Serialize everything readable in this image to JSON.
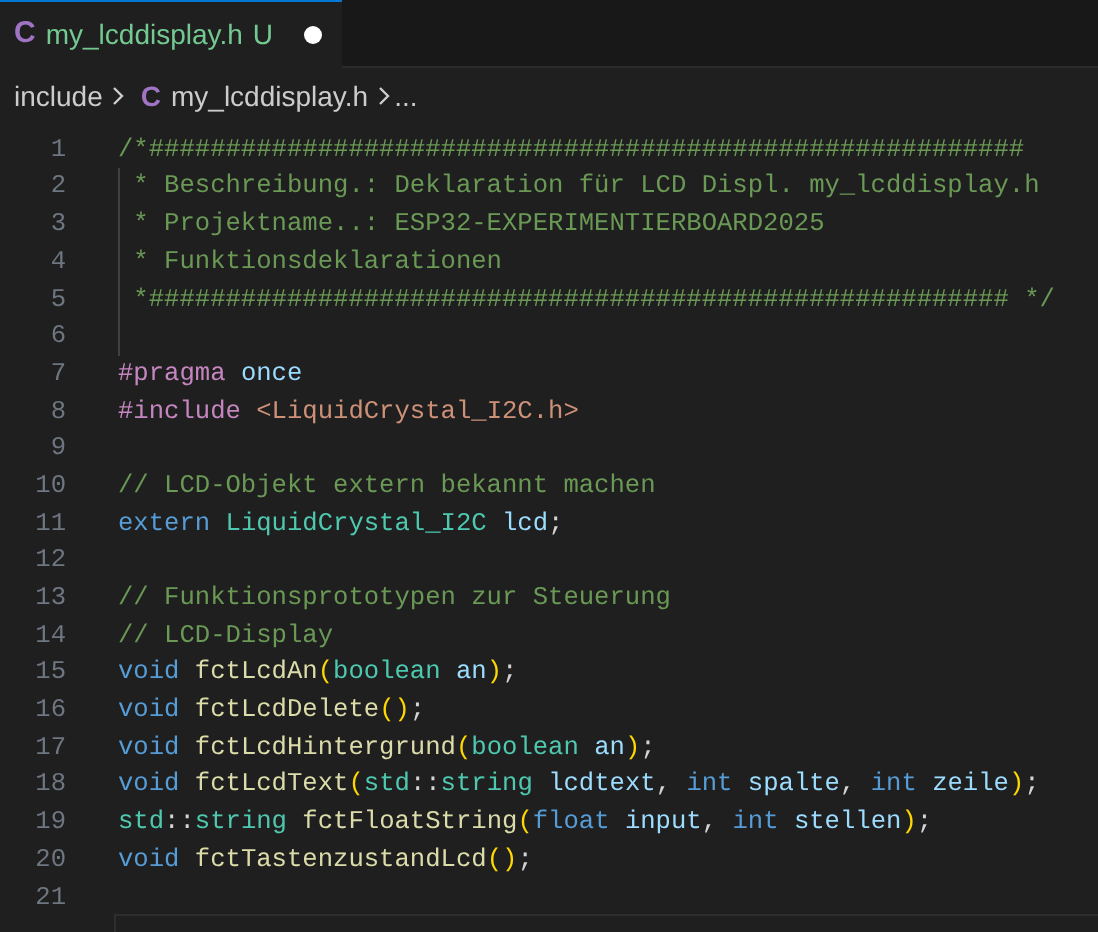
{
  "tabs": [
    {
      "icon": "C",
      "label": "my_lcddisplay.h",
      "status": "U",
      "modified": true,
      "selected": true
    }
  ],
  "breadcrumb": [
    {
      "text": "include",
      "kind": "folder"
    },
    {
      "icon": "C",
      "text": "my_lcddisplay.h",
      "kind": "file"
    },
    {
      "text": "...",
      "kind": "more"
    }
  ],
  "lines": [
    {
      "number": "1",
      "tokens": [
        {
          "text": "/*#########################################################",
          "kind": "comment"
        }
      ]
    },
    {
      "number": "2",
      "tokens": [
        {
          "text": " * Beschreibung.: Deklaration für LCD Displ. my_lcddisplay.h",
          "kind": "comment"
        }
      ]
    },
    {
      "number": "3",
      "tokens": [
        {
          "text": " * Projektname..: ESP32-EXPERIMENTIERBOARD2025",
          "kind": "comment"
        }
      ]
    },
    {
      "number": "4",
      "tokens": [
        {
          "text": " * Funktionsdeklarationen",
          "kind": "comment"
        }
      ]
    },
    {
      "number": "5",
      "tokens": [
        {
          "text": " *######################################################## */",
          "kind": "comment"
        }
      ]
    },
    {
      "number": "6"
    },
    {
      "number": "7",
      "tokens": [
        {
          "text": "#pragma ",
          "kind": "directive"
        },
        {
          "text": "once",
          "kind": "variable"
        }
      ]
    },
    {
      "number": "8",
      "tokens": [
        {
          "text": "#include ",
          "kind": "directive"
        },
        {
          "text": "<LiquidCrystal_I2C.h>",
          "kind": "string"
        }
      ]
    },
    {
      "number": "9"
    },
    {
      "number": "10",
      "tokens": [
        {
          "text": "// LCD-Objekt extern bekannt machen",
          "kind": "comment"
        }
      ]
    },
    {
      "number": "11",
      "tokens": [
        {
          "text": "extern ",
          "kind": "keyword"
        },
        {
          "text": "LiquidCrystal_I2C ",
          "kind": "type"
        },
        {
          "text": "lcd",
          "kind": "variable"
        },
        {
          "text": ";",
          "kind": "plain"
        }
      ]
    },
    {
      "number": "12"
    },
    {
      "number": "13",
      "tokens": [
        {
          "text": "// Funktionsprototypen zur Steuerung",
          "kind": "comment"
        }
      ]
    },
    {
      "number": "14",
      "tokens": [
        {
          "text": "// LCD-Display",
          "kind": "comment"
        }
      ]
    },
    {
      "number": "15",
      "tokens": [
        {
          "text": "void ",
          "kind": "keyword"
        },
        {
          "text": "fctLcdAn",
          "kind": "function"
        },
        {
          "text": "(",
          "kind": "bracket"
        },
        {
          "text": "boolean ",
          "kind": "type"
        },
        {
          "text": "an",
          "kind": "variable"
        },
        {
          "text": ")",
          "kind": "bracket"
        },
        {
          "text": ";",
          "kind": "plain"
        }
      ]
    },
    {
      "number": "16",
      "tokens": [
        {
          "text": "void ",
          "kind": "keyword"
        },
        {
          "text": "fctLcdDelete",
          "kind": "function"
        },
        {
          "text": "()",
          "kind": "bracket"
        },
        {
          "text": ";",
          "kind": "plain"
        }
      ]
    },
    {
      "number": "17",
      "tokens": [
        {
          "text": "void ",
          "kind": "keyword"
        },
        {
          "text": "fctLcdHintergrund",
          "kind": "function"
        },
        {
          "text": "(",
          "kind": "bracket"
        },
        {
          "text": "boolean ",
          "kind": "type"
        },
        {
          "text": "an",
          "kind": "variable"
        },
        {
          "text": ")",
          "kind": "bracket"
        },
        {
          "text": ";",
          "kind": "plain"
        }
      ]
    },
    {
      "number": "18",
      "tokens": [
        {
          "text": "void ",
          "kind": "keyword"
        },
        {
          "text": "fctLcdText",
          "kind": "function"
        },
        {
          "text": "(",
          "kind": "bracket"
        },
        {
          "text": "std",
          "kind": "type"
        },
        {
          "text": "::",
          "kind": "plain"
        },
        {
          "text": "string ",
          "kind": "type"
        },
        {
          "text": "lcdtext",
          "kind": "variable"
        },
        {
          "text": ", ",
          "kind": "plain"
        },
        {
          "text": "int ",
          "kind": "keyword"
        },
        {
          "text": "spalte",
          "kind": "variable"
        },
        {
          "text": ", ",
          "kind": "plain"
        },
        {
          "text": "int ",
          "kind": "keyword"
        },
        {
          "text": "zeile",
          "kind": "variable"
        },
        {
          "text": ")",
          "kind": "bracket"
        },
        {
          "text": ";",
          "kind": "plain"
        }
      ]
    },
    {
      "number": "19",
      "tokens": [
        {
          "text": "std",
          "kind": "type"
        },
        {
          "text": "::",
          "kind": "plain"
        },
        {
          "text": "string ",
          "kind": "type"
        },
        {
          "text": "fctFloatString",
          "kind": "function"
        },
        {
          "text": "(",
          "kind": "bracket"
        },
        {
          "text": "float ",
          "kind": "keyword"
        },
        {
          "text": "input",
          "kind": "variable"
        },
        {
          "text": ", ",
          "kind": "plain"
        },
        {
          "text": "int ",
          "kind": "keyword"
        },
        {
          "text": "stellen",
          "kind": "variable"
        },
        {
          "text": ")",
          "kind": "bracket"
        },
        {
          "text": ";",
          "kind": "plain"
        }
      ]
    },
    {
      "number": "20",
      "tokens": [
        {
          "text": "void ",
          "kind": "keyword"
        },
        {
          "text": "fctTastenzustandLcd",
          "kind": "function"
        },
        {
          "text": "()",
          "kind": "bracket"
        },
        {
          "text": ";",
          "kind": "plain"
        }
      ]
    },
    {
      "number": "21"
    }
  ]
}
